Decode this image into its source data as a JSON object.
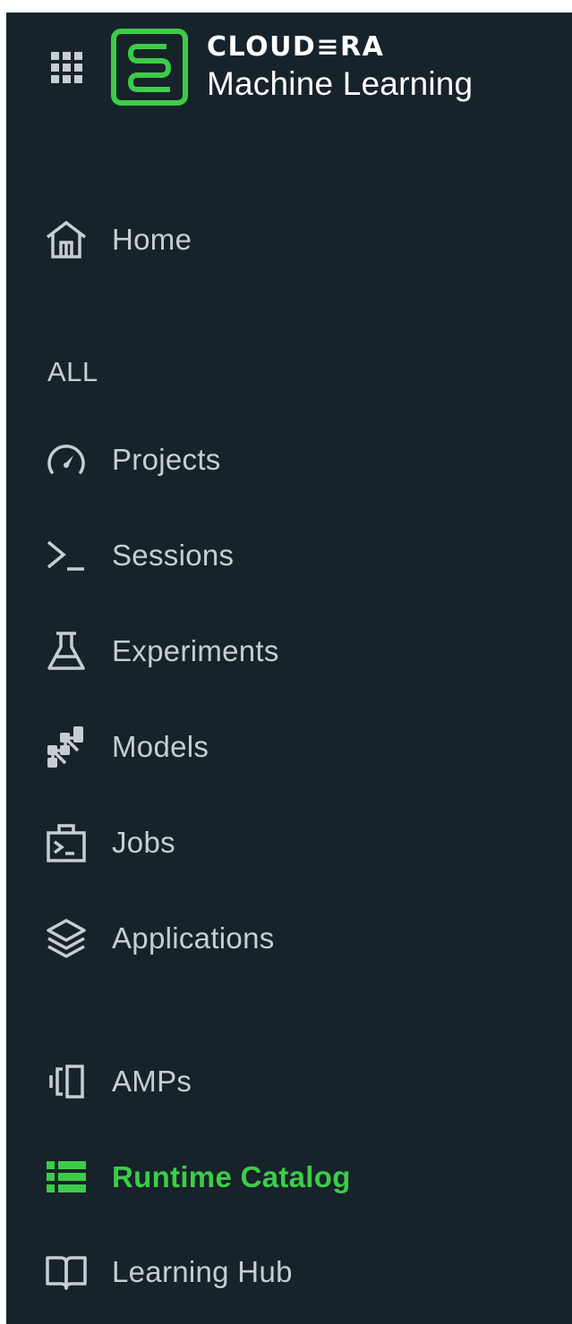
{
  "brand": {
    "name": "CLOUD≡RA",
    "product": "Machine Learning",
    "accent_color": "#3dcc4a"
  },
  "header": {
    "app_switcher_icon": "grid-icon",
    "logo_icon": "cloudera-logo"
  },
  "nav": {
    "home": {
      "label": "Home",
      "icon": "home-icon"
    },
    "section_all": "ALL",
    "items": [
      {
        "label": "Projects",
        "icon": "gauge-icon"
      },
      {
        "label": "Sessions",
        "icon": "terminal-prompt-icon"
      },
      {
        "label": "Experiments",
        "icon": "flask-icon"
      },
      {
        "label": "Models",
        "icon": "network-nodes-icon"
      },
      {
        "label": "Jobs",
        "icon": "job-terminal-icon"
      },
      {
        "label": "Applications",
        "icon": "layers-icon"
      }
    ],
    "bottom_items": [
      {
        "label": "AMPs",
        "icon": "amps-icon",
        "active": false
      },
      {
        "label": "Runtime Catalog",
        "icon": "list-icon",
        "active": true
      },
      {
        "label": "Learning Hub",
        "icon": "book-icon",
        "active": false
      }
    ]
  },
  "colors": {
    "sidebar_bg": "#17232a",
    "text": "#c7ced3",
    "active": "#3dcc4a"
  }
}
